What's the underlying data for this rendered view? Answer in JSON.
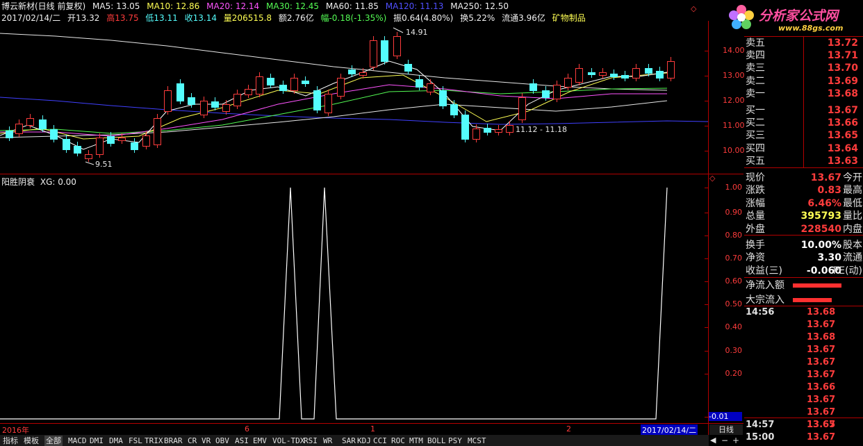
{
  "header": {
    "stock": "博云新材(日线 前复权)",
    "ma5": "MA5: 13.05",
    "ma10": "MA10: 12.86",
    "ma20": "MA20: 12.14",
    "ma30": "MA30: 12.45",
    "ma60": "MA60: 11.85",
    "ma120": "MA120: 11.13",
    "ma250": "MA250: 12.50",
    "date": "2017/02/14/二",
    "open": "开13.32",
    "high": "高13.75",
    "low": "低13.11",
    "close": "收13.14",
    "vol": "量206515.8",
    "amount": "额2.76亿",
    "change": "幅-0.18(-1.35%)",
    "amp": "振0.64(4.80%)",
    "turnover": "换5.22%",
    "float": "流通3.96亿",
    "industry": "矿物制品"
  },
  "logo": {
    "text": "分析家公式网",
    "url": "www.88gs.com"
  },
  "price_axis": [
    "14.00",
    "13.00",
    "12.00",
    "11.00",
    "10.00"
  ],
  "annotations": {
    "high": "14.91",
    "low": "9.51",
    "range": "11.12 - 11.18"
  },
  "indicator": {
    "title": "阳胜阴衰",
    "xg": "XG: 0.00",
    "axis": [
      "1.00",
      "0.90",
      "0.80",
      "0.70",
      "0.60",
      "0.50",
      "0.40",
      "0.30",
      "0.20",
      "-0.01"
    ]
  },
  "dates": [
    "2016年",
    "6",
    "1",
    "2"
  ],
  "current_date": "2017/02/14/二",
  "orderbook": {
    "sell": [
      {
        "label": "卖五",
        "price": "13.72"
      },
      {
        "label": "卖四",
        "price": "13.71"
      },
      {
        "label": "卖三",
        "price": "13.70"
      },
      {
        "label": "卖二",
        "price": "13.69"
      },
      {
        "label": "卖一",
        "price": "13.68"
      }
    ],
    "buy": [
      {
        "label": "买一",
        "price": "13.67"
      },
      {
        "label": "买二",
        "price": "13.66"
      },
      {
        "label": "买三",
        "price": "13.65"
      },
      {
        "label": "买四",
        "price": "13.64"
      },
      {
        "label": "买五",
        "price": "13.63"
      }
    ]
  },
  "quote": [
    {
      "k": "现价",
      "v": "13.67",
      "k2": "今开",
      "color": "#ff3c3c"
    },
    {
      "k": "涨跌",
      "v": "0.83",
      "k2": "最高",
      "color": "#ff3c3c"
    },
    {
      "k": "涨幅",
      "v": "6.46%",
      "k2": "最低",
      "color": "#ff3c3c"
    },
    {
      "k": "总量",
      "v": "395793",
      "k2": "量比",
      "color": "#ffff54"
    },
    {
      "k": "外盘",
      "v": "228540",
      "k2": "内盘",
      "color": "#ff3c3c"
    }
  ],
  "finance": [
    {
      "k": "换手",
      "v": "10.00%",
      "k2": "股本"
    },
    {
      "k": "净资",
      "v": "3.30",
      "k2": "流通"
    },
    {
      "k": "收益(三)",
      "v": "-0.060",
      "k2": "PE(动)"
    }
  ],
  "flows": [
    {
      "k": "净流入额"
    },
    {
      "k": "大宗流入"
    }
  ],
  "ticks": [
    {
      "t": "14:56",
      "p": "13.68"
    },
    {
      "t": "",
      "p": "13.67"
    },
    {
      "t": "",
      "p": "13.68"
    },
    {
      "t": "",
      "p": "13.67"
    },
    {
      "t": "",
      "p": "13.67"
    },
    {
      "t": "",
      "p": "13.67"
    },
    {
      "t": "",
      "p": "13.66"
    },
    {
      "t": "",
      "p": "13.67"
    },
    {
      "t": "",
      "p": "13.67"
    },
    {
      "t": "",
      "p": "13.67"
    },
    {
      "t": "14:57",
      "p": "13.65"
    },
    {
      "t": "15:00",
      "p": "13.67"
    }
  ],
  "side_tabs": [
    "日线"
  ],
  "tabs": [
    "指标",
    "模板",
    "全部",
    "MACD",
    "DMI",
    "DMA",
    "FSL",
    "TRIX",
    "BRAR",
    "CR",
    "VR",
    "OBV",
    "ASI",
    "EMV",
    "VOL-TDX",
    "RSI",
    "WR",
    "SAR",
    "KDJ",
    "CCI",
    "ROC",
    "MTM",
    "BOLL",
    "PSY",
    "MCST"
  ],
  "colors": {
    "up": "#ff3c3c",
    "down": "#54fcfc",
    "grid": "#b40000"
  }
}
